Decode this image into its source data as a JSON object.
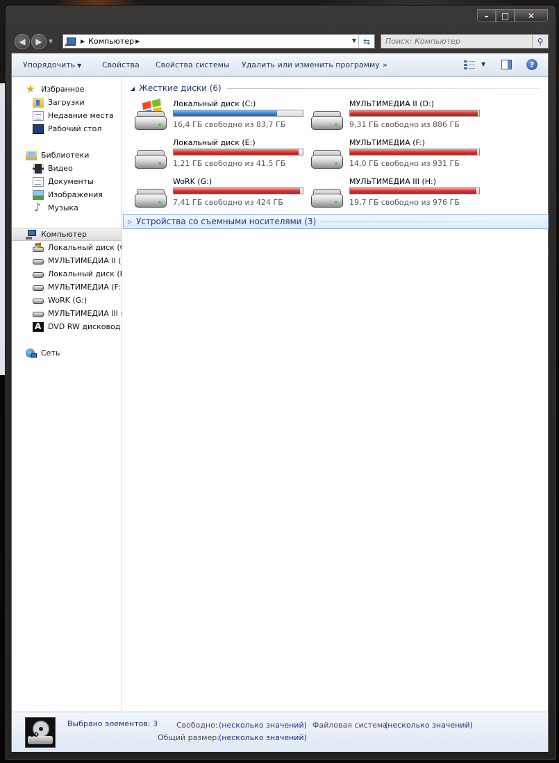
{
  "window": {
    "caption_buttons": [
      "minimize",
      "maximize",
      "close"
    ]
  },
  "address": {
    "path": "Компьютер",
    "search_placeholder": "Поиск: Компьютер"
  },
  "toolbar": {
    "organize": "Упорядочить",
    "properties": "Свойства",
    "system_properties": "Свойства системы",
    "uninstall": "Удалить или изменить программу",
    "more": "»"
  },
  "sidebar": {
    "favorites": {
      "label": "Избранное",
      "items": [
        "Загрузки",
        "Недавние места",
        "Рабочий стол"
      ]
    },
    "libraries": {
      "label": "Библиотеки",
      "items": [
        "Видео",
        "Документы",
        "Изображения",
        "Музыка"
      ]
    },
    "computer": {
      "label": "Компьютер",
      "items": [
        "Локальный диск (C:)",
        "МУЛЬТИМЕДИА II (D:",
        "Локальный диск (E:)",
        "МУЛЬТИМЕДИА (F:)",
        "WoRK (G:)",
        "МУЛЬТИМЕДИА III (H",
        "DVD RW дисковод (I"
      ]
    },
    "network": {
      "label": "Сеть"
    }
  },
  "groups": {
    "hard_disks": "Жесткие диски (6)",
    "removable": "Устройства со съемными носителями (3)"
  },
  "drives": [
    {
      "name": "Локальный диск (C:)",
      "info": "16,4 ГБ свободно из 83,7 ГБ",
      "used_fraction": 0.8,
      "bar_color": "#2f74c8",
      "icon": "windows-drive-icon"
    },
    {
      "name": "МУЛЬТИМЕДИА II (D:)",
      "info": "9,31 ГБ свободно из 886 ГБ",
      "used_fraction": 0.99,
      "bar_color": "#d22b2b",
      "icon": "hard-drive-icon"
    },
    {
      "name": "Локальный диск (E:)",
      "info": "1,21 ГБ свободно из 41,5 ГБ",
      "used_fraction": 0.97,
      "bar_color": "#d22b2b",
      "icon": "hard-drive-icon"
    },
    {
      "name": "МУЛЬТИМЕДИА (F:)",
      "info": "14,0 ГБ свободно из 931 ГБ",
      "used_fraction": 0.985,
      "bar_color": "#d22b2b",
      "icon": "hard-drive-icon"
    },
    {
      "name": "WoRK (G:)",
      "info": "7,41 ГБ свободно из 424 ГБ",
      "used_fraction": 0.98,
      "bar_color": "#d22b2b",
      "icon": "hard-drive-icon"
    },
    {
      "name": "МУЛЬТИМЕДИА III (H:)",
      "info": "19,7 ГБ свободно из 976 ГБ",
      "used_fraction": 0.98,
      "bar_color": "#d22b2b",
      "icon": "hard-drive-icon"
    }
  ],
  "details": {
    "selected": "Выбрано элементов: 3",
    "free_key": "Свободно:",
    "free_val": "(несколько значений)",
    "total_key": "Общий размер:",
    "total_val": "(несколько значений)",
    "fs_key": "Файловая система:",
    "fs_val": "(несколько значений)",
    "icon_badge": "BD"
  }
}
